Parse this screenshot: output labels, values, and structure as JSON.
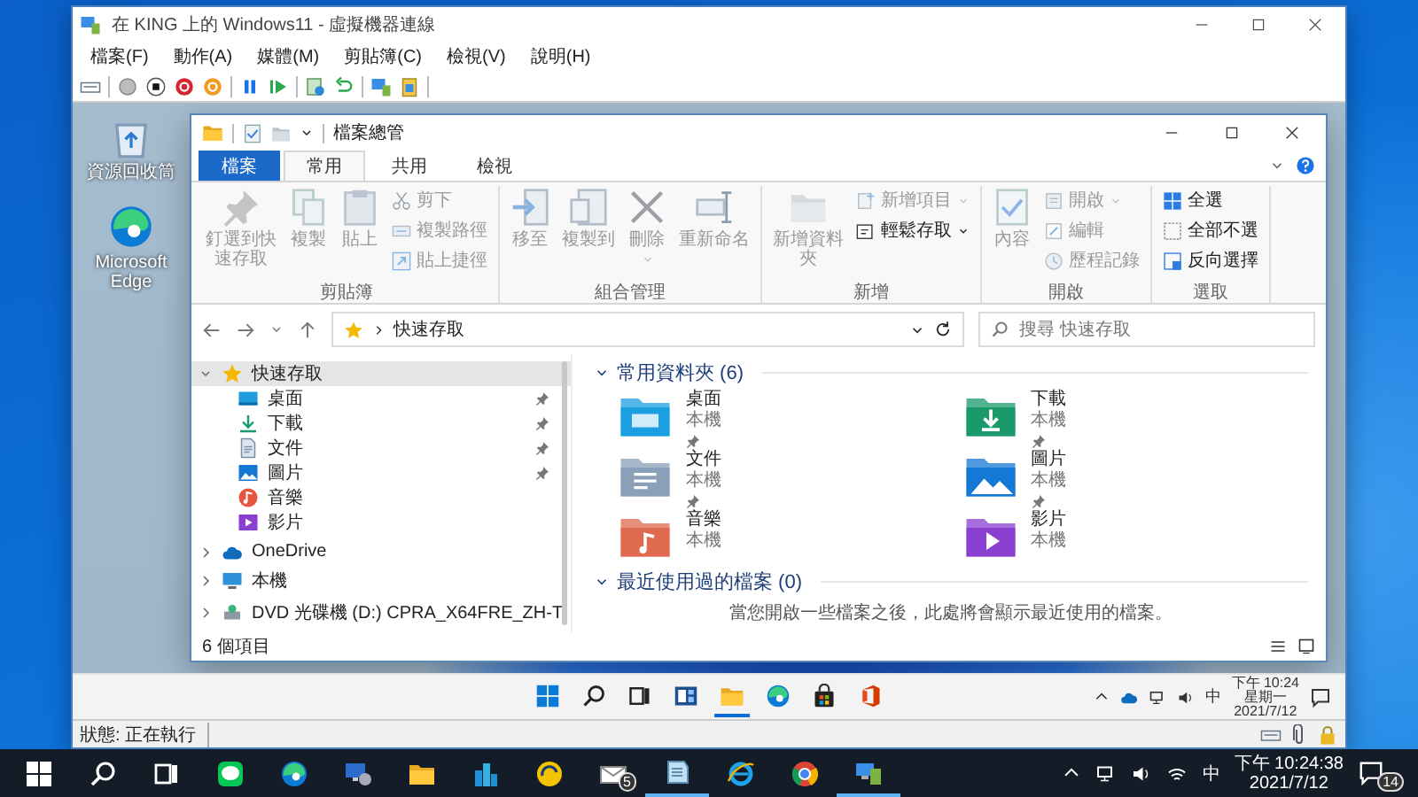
{
  "vm_window": {
    "title": "在 KING 上的 Windows11 - 虛擬機器連線",
    "menu": [
      "檔案(F)",
      "動作(A)",
      "媒體(M)",
      "剪貼簿(C)",
      "檢視(V)",
      "說明(H)"
    ],
    "desktop_icons": [
      {
        "label": "資源回收筒",
        "kind": "recycle"
      },
      {
        "label": "Microsoft Edge",
        "kind": "edge"
      }
    ],
    "explorer": {
      "title": "檔案總管",
      "tabs": [
        {
          "label": "檔案",
          "kind": "file",
          "selected": false
        },
        {
          "label": "常用",
          "kind": "tab",
          "selected": true
        },
        {
          "label": "共用",
          "kind": "tab",
          "selected": false
        },
        {
          "label": "檢視",
          "kind": "tab",
          "selected": false
        }
      ],
      "ribbon": [
        {
          "label": "剪貼簿",
          "items": [
            {
              "label": "釘選到快速存取",
              "kind": "large",
              "disabled": true,
              "dropdown": false
            },
            {
              "label": "複製",
              "kind": "large",
              "disabled": true,
              "dropdown": false
            },
            {
              "label": "貼上",
              "kind": "large",
              "disabled": true,
              "dropdown": false
            },
            {
              "label": "剪下",
              "kind": "small",
              "disabled": true,
              "dropdown": false
            },
            {
              "label": "複製路徑",
              "kind": "small",
              "disabled": true,
              "dropdown": false
            },
            {
              "label": "貼上捷徑",
              "kind": "small",
              "disabled": true,
              "dropdown": false
            }
          ]
        },
        {
          "label": "組合管理",
          "items": [
            {
              "label": "移至",
              "kind": "large",
              "disabled": true,
              "dropdown": false
            },
            {
              "label": "複製到",
              "kind": "large",
              "disabled": true,
              "dropdown": false
            },
            {
              "label": "刪除",
              "kind": "large",
              "disabled": true,
              "dropdown": true
            },
            {
              "label": "重新命名",
              "kind": "large",
              "disabled": true,
              "dropdown": false
            }
          ]
        },
        {
          "label": "新增",
          "items": [
            {
              "label": "新增資料夾",
              "kind": "large",
              "disabled": true,
              "dropdown": false
            },
            {
              "label": "新增項目",
              "kind": "small",
              "disabled": true,
              "dropdown": true
            },
            {
              "label": "輕鬆存取",
              "kind": "small",
              "disabled": false,
              "dropdown": true
            }
          ]
        },
        {
          "label": "開啟",
          "items": [
            {
              "label": "內容",
              "kind": "large",
              "disabled": true,
              "dropdown": false
            },
            {
              "label": "開啟",
              "kind": "small",
              "disabled": true,
              "dropdown": true
            },
            {
              "label": "編輯",
              "kind": "small",
              "disabled": true,
              "dropdown": false
            },
            {
              "label": "歷程記錄",
              "kind": "small",
              "disabled": true,
              "dropdown": false
            }
          ]
        },
        {
          "label": "選取",
          "items": [
            {
              "label": "全選",
              "kind": "small",
              "disabled": false,
              "dropdown": false
            },
            {
              "label": "全部不選",
              "kind": "small",
              "disabled": false,
              "dropdown": false
            },
            {
              "label": "反向選擇",
              "kind": "small",
              "disabled": false,
              "dropdown": false
            }
          ]
        }
      ],
      "address": "快速存取",
      "search": {
        "placeholder": "搜尋 快速存取"
      },
      "nav": [
        {
          "label": "快速存取",
          "kind": "star",
          "expanded": true,
          "selected": true,
          "children": [
            {
              "label": "桌面",
              "kind": "desktop",
              "pinned": true,
              "selected": false
            },
            {
              "label": "下載",
              "kind": "downloads",
              "pinned": true,
              "selected": false
            },
            {
              "label": "文件",
              "kind": "documents",
              "pinned": true,
              "selected": false
            },
            {
              "label": "圖片",
              "kind": "pictures",
              "pinned": true,
              "selected": false
            },
            {
              "label": "音樂",
              "kind": "music",
              "pinned": false,
              "selected": false
            },
            {
              "label": "影片",
              "kind": "videos",
              "pinned": false,
              "selected": false
            }
          ]
        },
        {
          "label": "OneDrive",
          "kind": "cloud",
          "expanded": false,
          "selected": false
        },
        {
          "label": "本機",
          "kind": "pc",
          "expanded": false,
          "selected": false
        },
        {
          "label": "DVD 光碟機 (D:) CPRA_X64FRE_ZH-T",
          "kind": "dvd",
          "expanded": false,
          "selected": false
        }
      ],
      "sections": [
        {
          "title": "常用資料夾 (6)",
          "expanded": true,
          "folders": [
            {
              "name": "桌面",
              "location": "本機",
              "kind": "desktop",
              "pinned": true
            },
            {
              "name": "下載",
              "location": "本機",
              "kind": "downloads",
              "pinned": true
            },
            {
              "name": "文件",
              "location": "本機",
              "kind": "documents",
              "pinned": true
            },
            {
              "name": "圖片",
              "location": "本機",
              "kind": "pictures",
              "pinned": true
            },
            {
              "name": "音樂",
              "location": "本機",
              "kind": "music",
              "pinned": false
            },
            {
              "name": "影片",
              "location": "本機",
              "kind": "videos",
              "pinned": false
            }
          ]
        },
        {
          "title": "最近使用過的檔案 (0)",
          "expanded": true,
          "empty_text": "當您開啟一些檔案之後，此處將會顯示最近使用的檔案。"
        }
      ],
      "status": "6 個項目"
    },
    "taskbar": {
      "apps": [
        {
          "kind": "start",
          "running": false
        },
        {
          "kind": "search",
          "running": false
        },
        {
          "kind": "taskview",
          "running": false
        },
        {
          "kind": "widgets",
          "running": false
        },
        {
          "kind": "explorer",
          "running": true
        },
        {
          "kind": "edge",
          "running": false
        },
        {
          "kind": "store",
          "running": false
        },
        {
          "kind": "office",
          "running": false
        }
      ],
      "ime": "中",
      "time": "下午 10:24",
      "weekday": "星期一",
      "date": "2021/7/12"
    },
    "status": "狀態: 正在執行"
  },
  "host_taskbar": {
    "apps": [
      {
        "kind": "start",
        "running": false
      },
      {
        "kind": "search",
        "running": false
      },
      {
        "kind": "taskview",
        "running": false
      },
      {
        "kind": "chat",
        "running": false
      },
      {
        "kind": "edge",
        "running": false
      },
      {
        "kind": "remote",
        "running": false
      },
      {
        "kind": "explorer",
        "running": false
      },
      {
        "kind": "buildings",
        "running": false
      },
      {
        "kind": "ring",
        "running": false
      },
      {
        "kind": "mail",
        "running": false,
        "badge": "5"
      },
      {
        "kind": "notes",
        "running": true
      },
      {
        "kind": "ie",
        "running": false
      },
      {
        "kind": "chrome",
        "running": false
      },
      {
        "kind": "vm",
        "running": true
      }
    ],
    "ime": "中",
    "time": "下午 10:24:38",
    "date": "2021/7/12",
    "notifications": "14"
  }
}
